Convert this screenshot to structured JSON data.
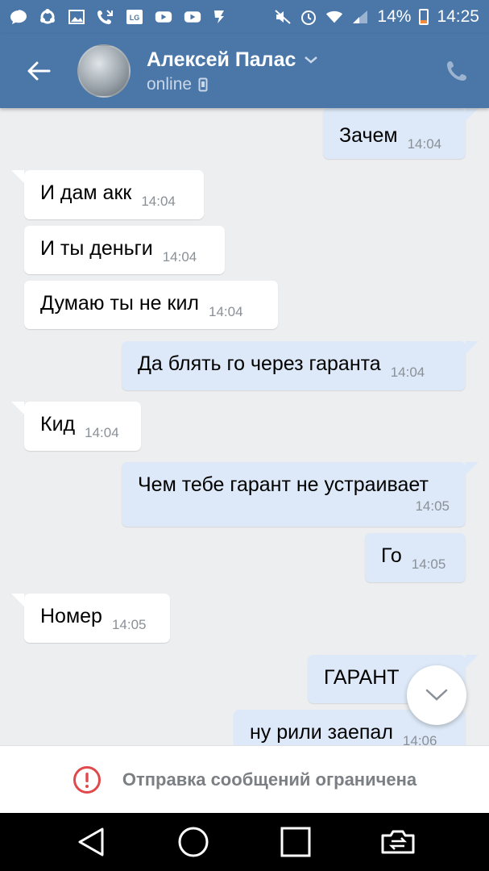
{
  "status_bar": {
    "battery": "14%",
    "time": "14:25",
    "icons": [
      "message-icon",
      "sync-icon",
      "gallery-icon",
      "missed-call-icon",
      "lg-icon",
      "youtube-icon",
      "youtube-icon",
      "check-icon",
      "mute-icon",
      "alarm-icon",
      "wifi-icon",
      "signal-icon",
      "battery-icon"
    ]
  },
  "header": {
    "name": "Алексей Палас",
    "status": "online"
  },
  "messages": [
    {
      "dir": "out",
      "text": "Зачем",
      "time": "14:04"
    },
    {
      "dir": "in",
      "text": "И дам акк",
      "time": "14:04"
    },
    {
      "dir": "in",
      "text": "И ты деньги",
      "time": "14:04"
    },
    {
      "dir": "in",
      "text": "Думаю ты не кил",
      "time": "14:04"
    },
    {
      "dir": "out",
      "text": "Да блять го через гаранта",
      "time": "14:04"
    },
    {
      "dir": "in",
      "text": "Кид",
      "time": "14:04"
    },
    {
      "dir": "out",
      "text": "Чем тебе гарант не устраивает",
      "time": "14:05"
    },
    {
      "dir": "out",
      "text": "Го",
      "time": "14:05"
    },
    {
      "dir": "in",
      "text": "Номер",
      "time": "14:05"
    },
    {
      "dir": "out",
      "text": "ГАРАНТ",
      "time": ""
    },
    {
      "dir": "out",
      "text": "ну рили заепал",
      "time": "14:06"
    }
  ],
  "restriction": {
    "text": "Отправка сообщений ограничена",
    "icon": "alert-circle-icon",
    "color": "#e0494c"
  },
  "colors": {
    "header": "#4a76a8",
    "incoming": "#ffffff",
    "outgoing": "#dde9f8",
    "background": "#edeef0"
  }
}
